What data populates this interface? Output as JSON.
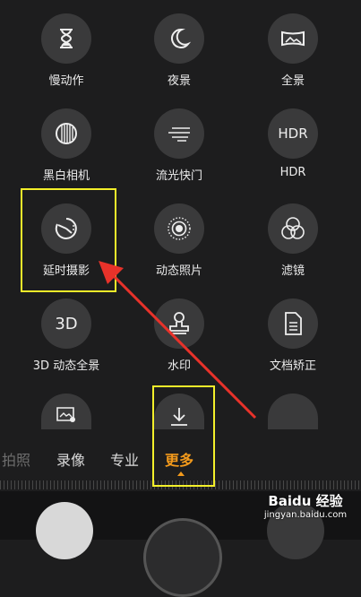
{
  "modes": [
    {
      "id": "slowmo",
      "label": "慢动作",
      "icon": "hourglass-icon"
    },
    {
      "id": "night",
      "label": "夜景",
      "icon": "moon-icon"
    },
    {
      "id": "panorama",
      "label": "全景",
      "icon": "panorama-icon"
    },
    {
      "id": "monochrome",
      "label": "黑白相机",
      "icon": "aperture-icon"
    },
    {
      "id": "light-painting",
      "label": "流光快门",
      "icon": "light-streak-icon"
    },
    {
      "id": "hdr",
      "label": "HDR",
      "icon_text": "HDR",
      "icon": "hdr-icon"
    },
    {
      "id": "timelapse",
      "label": "延时摄影",
      "icon": "timelapse-icon"
    },
    {
      "id": "moving-picture",
      "label": "动态照片",
      "icon": "moving-picture-icon"
    },
    {
      "id": "filter",
      "label": "滤镜",
      "icon": "filter-icon"
    },
    {
      "id": "3d-panorama",
      "label": "3D 动态全景",
      "icon_text": "3D",
      "icon": "3d-icon"
    },
    {
      "id": "watermark",
      "label": "水印",
      "icon": "stamp-icon"
    },
    {
      "id": "document",
      "label": "文档矫正",
      "icon": "document-icon"
    },
    {
      "id": "more5a",
      "label": "",
      "icon": "picture-voice-icon"
    },
    {
      "id": "download",
      "label": "",
      "icon": "download-icon"
    },
    {
      "id": "more5c",
      "label": "",
      "icon": ""
    }
  ],
  "tabs": {
    "photo": "拍照",
    "video": "录像",
    "pro": "专业",
    "more": "更多"
  },
  "accent_color": "#f39a1c",
  "highlight_color": "#f3ef2a",
  "arrow_color": "#e8322a",
  "watermark": {
    "title": "Baidu 经验",
    "sub": "jingyan.baidu.com"
  }
}
